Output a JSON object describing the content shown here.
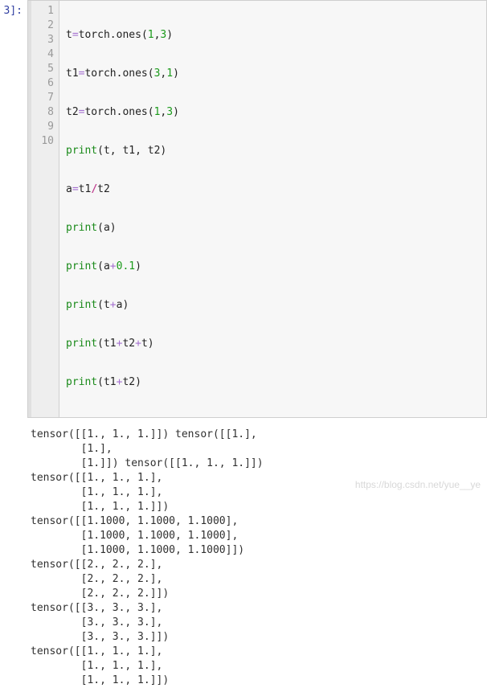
{
  "prompt": "3]:",
  "code": {
    "lines": [
      {
        "n": "1",
        "t_raw": "t=torch.ones(1,3)"
      },
      {
        "n": "2",
        "t_raw": "t1=torch.ones(3,1)"
      },
      {
        "n": "3",
        "t_raw": "t2=torch.ones(1,3)"
      },
      {
        "n": "4",
        "t_raw": "print(t, t1, t2)"
      },
      {
        "n": "5",
        "t_raw": "a=t1/t2"
      },
      {
        "n": "6",
        "t_raw": "print(a)"
      },
      {
        "n": "7",
        "t_raw": "print(a+0.1)"
      },
      {
        "n": "8",
        "t_raw": "print(t+a)"
      },
      {
        "n": "9",
        "t_raw": "print(t1+t2+t)"
      },
      {
        "n": "10",
        "t_raw": "print(t1+t2)"
      }
    ]
  },
  "output": [
    "tensor([[1., 1., 1.]]) tensor([[1.],",
    "        [1.],",
    "        [1.]]) tensor([[1., 1., 1.]])",
    "tensor([[1., 1., 1.],",
    "        [1., 1., 1.],",
    "        [1., 1., 1.]])",
    "tensor([[1.1000, 1.1000, 1.1000],",
    "        [1.1000, 1.1000, 1.1000],",
    "        [1.1000, 1.1000, 1.1000]])",
    "tensor([[2., 2., 2.],",
    "        [2., 2., 2.],",
    "        [2., 2., 2.]])",
    "tensor([[3., 3., 3.],",
    "        [3., 3., 3.],",
    "        [3., 3., 3.]])",
    "tensor([[1., 1., 1.],",
    "        [1., 1., 1.],",
    "        [1., 1., 1.]])"
  ],
  "watermark": "https://blog.csdn.net/yue__ye"
}
